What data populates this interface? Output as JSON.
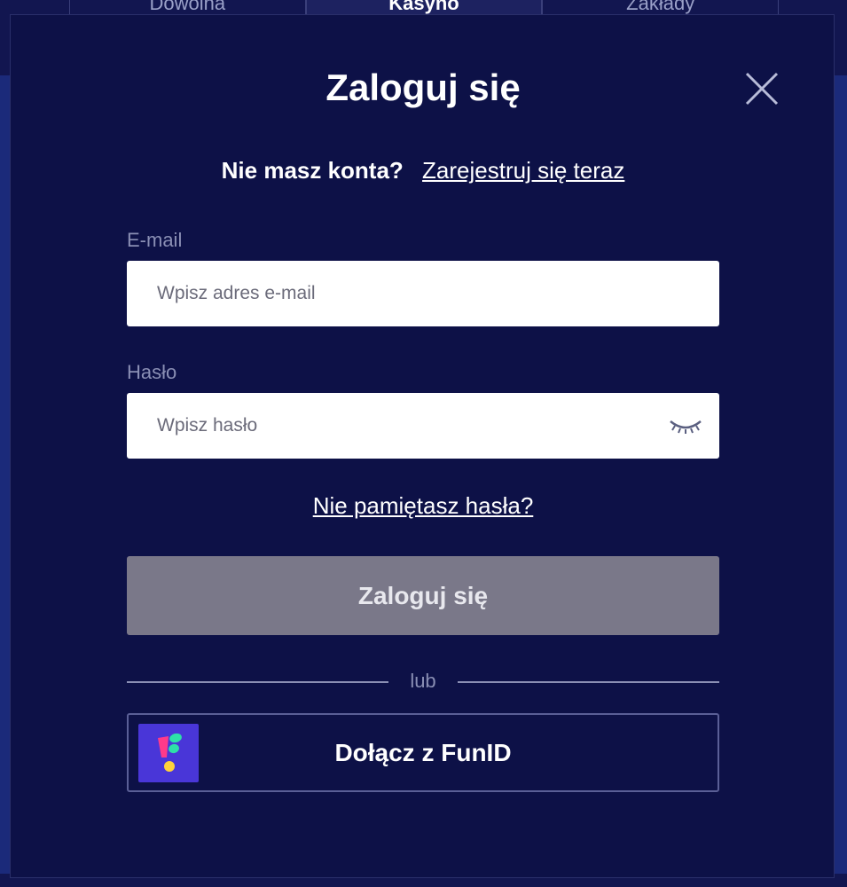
{
  "background": {
    "tabs": [
      "Dowolna",
      "Kasyno",
      "Zakłady"
    ],
    "active_tab": 1
  },
  "modal": {
    "title": "Zaloguj się",
    "register_question": "Nie masz konta?",
    "register_link": "Zarejestruj się teraz",
    "email": {
      "label": "E-mail",
      "placeholder": "Wpisz adres e-mail",
      "value": ""
    },
    "password": {
      "label": "Hasło",
      "placeholder": "Wpisz hasło",
      "value": ""
    },
    "forgot_link": "Nie pamiętasz hasła?",
    "login_button": "Zaloguj się",
    "divider_text": "lub",
    "funid_button": "Dołącz z FunID"
  },
  "icons": {
    "close": "close-icon",
    "eye": "eye-closed-icon",
    "funid_logo": "funid-logo-icon"
  },
  "colors": {
    "modal_bg": "#0d1147",
    "login_button_disabled": "#7a7889",
    "funid_brand": "#4936d8",
    "label_muted": "#8a8fb4"
  }
}
